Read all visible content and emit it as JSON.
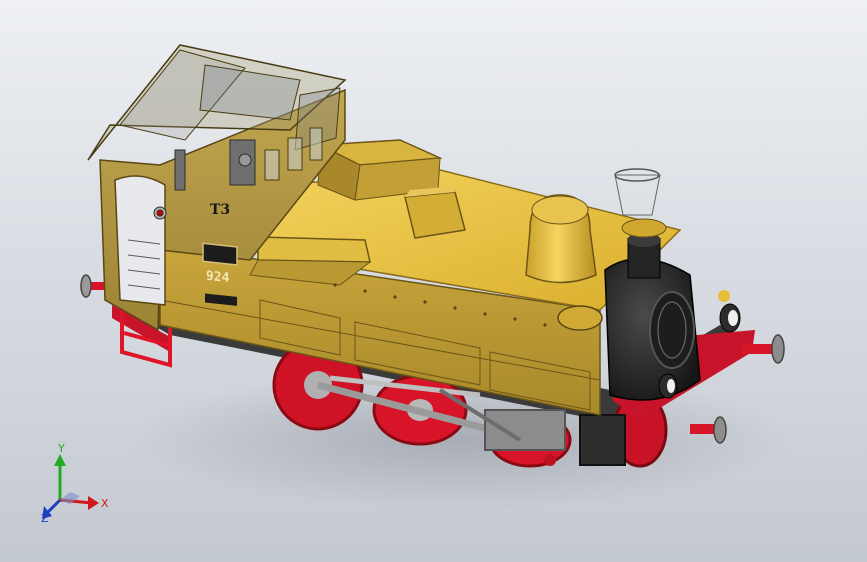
{
  "model": {
    "class_mark": "T3",
    "number": "924"
  },
  "triad": {
    "x_label": "X",
    "y_label": "Y",
    "z_label": "Z"
  },
  "colors": {
    "body_yellow": "#e0b83a",
    "body_yellow_light": "#f0cf55",
    "body_yellow_dark": "#a88722",
    "cab_olive": "#b49a45",
    "wheel_red": "#e01428",
    "smokebox_black": "#2a2a2a",
    "x_axis": "#d01818",
    "y_axis": "#22aa22",
    "z_axis": "#1e3fbf"
  }
}
